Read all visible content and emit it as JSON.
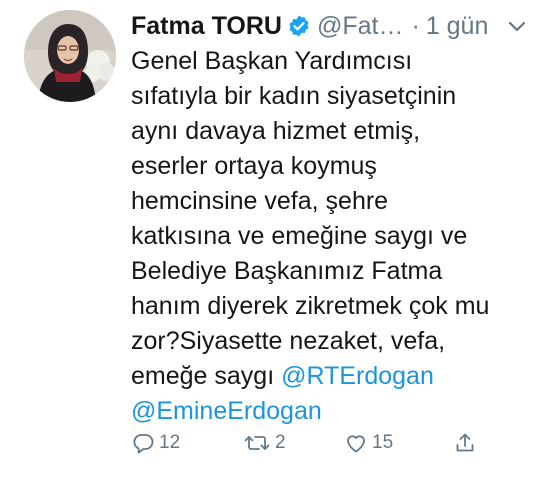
{
  "tweet": {
    "author": {
      "display_name": "Fatma TORU",
      "handle": "@Fat…",
      "time": "1 gün",
      "separator": "·",
      "verified": true
    },
    "body_lines": [
      "Genel Başkan Yardımcısı",
      "sıfatıyla bir kadın siyasetçinin",
      "aynı davaya hizmet etmiş,",
      "eserler ortaya koymuş",
      "hemcinsine vefa, şehre",
      "katkısına ve emeğine saygı ve",
      "Belediye Başkanımız Fatma",
      "hanım diyerek zikretmek çok mu",
      "zor?Siyasette nezaket, vefa,"
    ],
    "last_line_prefix": "emeğe saygı ",
    "mentions": [
      "@RTErdogan",
      "@EmineErdogan"
    ],
    "actions": {
      "reply": {
        "icon": "reply-icon",
        "count": "12"
      },
      "retweet": {
        "icon": "retweet-icon",
        "count": "2"
      },
      "like": {
        "icon": "heart-icon",
        "count": "15"
      },
      "share": {
        "icon": "share-icon"
      }
    }
  },
  "colors": {
    "text": "#14171a",
    "secondary": "#657786",
    "link": "#1b95e0",
    "verified": "#1da1f2"
  }
}
